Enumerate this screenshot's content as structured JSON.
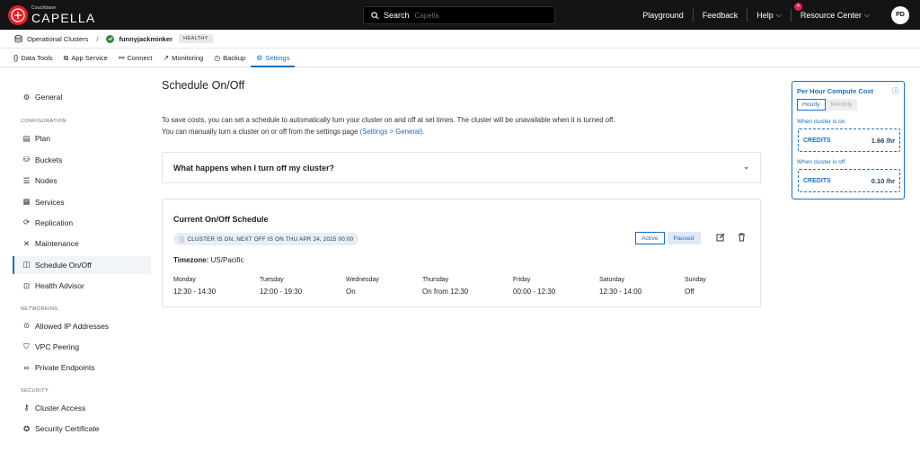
{
  "header": {
    "brand_small": "Couchbase",
    "brand_name": "CAPELLA",
    "search_label": "Search",
    "search_placeholder": "Capella",
    "nav": {
      "playground": "Playground",
      "feedback": "Feedback",
      "help": "Help",
      "resource_center": "Resource Center",
      "resource_badge": "4",
      "avatar_initials": "PD"
    }
  },
  "breadcrumb": {
    "root": "Operational Clusters",
    "separator": "/",
    "cluster": "funnyjackminker",
    "status": "HEALTHY"
  },
  "tabs": [
    {
      "label": "Data Tools",
      "icon": "{}"
    },
    {
      "label": "App Service",
      "icon": "⧉"
    },
    {
      "label": "Connect",
      "icon": "⚯"
    },
    {
      "label": "Monitoring",
      "icon": "↗"
    },
    {
      "label": "Backup",
      "icon": "◷"
    },
    {
      "label": "Settings",
      "icon": "⚙"
    }
  ],
  "sidebar": {
    "general": "General",
    "section_configuration": "CONFIGURATION",
    "plan": "Plan",
    "buckets": "Buckets",
    "nodes": "Nodes",
    "services": "Services",
    "replication": "Replication",
    "maintenance": "Maintenance",
    "schedule": "Schedule On/Off",
    "health_advisor": "Health Advisor",
    "section_networking": "NETWORKING",
    "allowed_ip": "Allowed IP Addresses",
    "vpc": "VPC Peering",
    "private_endpoints": "Private Endpoints",
    "section_security": "SECURITY",
    "cluster_access": "Cluster Access",
    "security_certificate": "Security Certificate"
  },
  "main": {
    "title": "Schedule On/Off",
    "desc_line1": "To save costs, you can set a schedule to automatically turn your cluster on and off at set times. The cluster will be unavailable when it is turned off.",
    "desc_line2_prefix": "You can manually turn a cluster on or off from the settings page ",
    "desc_link": "(Settings > General)",
    "desc_line2_suffix": ".",
    "accordion_title": "What happens when I turn off my cluster?",
    "schedule": {
      "title": "Current On/Off Schedule",
      "status": "CLUSTER IS ON, NEXT OFF IS ON THU APR 24, 2025 00:00",
      "active_label": "Active",
      "paused_label": "Paused",
      "timezone_label": "Timezone:",
      "timezone_value": "US/Pacific",
      "days": [
        {
          "name": "Monday",
          "time": "12:30 - 14:30"
        },
        {
          "name": "Tuesday",
          "time": "12:00 - 19:30"
        },
        {
          "name": "Wednesday",
          "time": "On"
        },
        {
          "name": "Thursday",
          "time": "On from 12:30"
        },
        {
          "name": "Friday",
          "time": "00:00 - 12:30"
        },
        {
          "name": "Saturday",
          "time": "12:30 - 14:00"
        },
        {
          "name": "Sunday",
          "time": "Off"
        }
      ]
    }
  },
  "compute": {
    "title": "Per Hour Compute Cost",
    "hourly": "Hourly",
    "monthly": "Monthly",
    "on_label": "When cluster is on",
    "off_label": "When cluster is off",
    "credits_label": "CREDITS",
    "on_value": "1.66 /hr",
    "off_value": "0.10 /hr"
  },
  "colors": {
    "accent": "#1b6ec2",
    "topbar": "#141414",
    "brand_red": "#e51f2a",
    "healthy_green": "#2e8b3e"
  }
}
